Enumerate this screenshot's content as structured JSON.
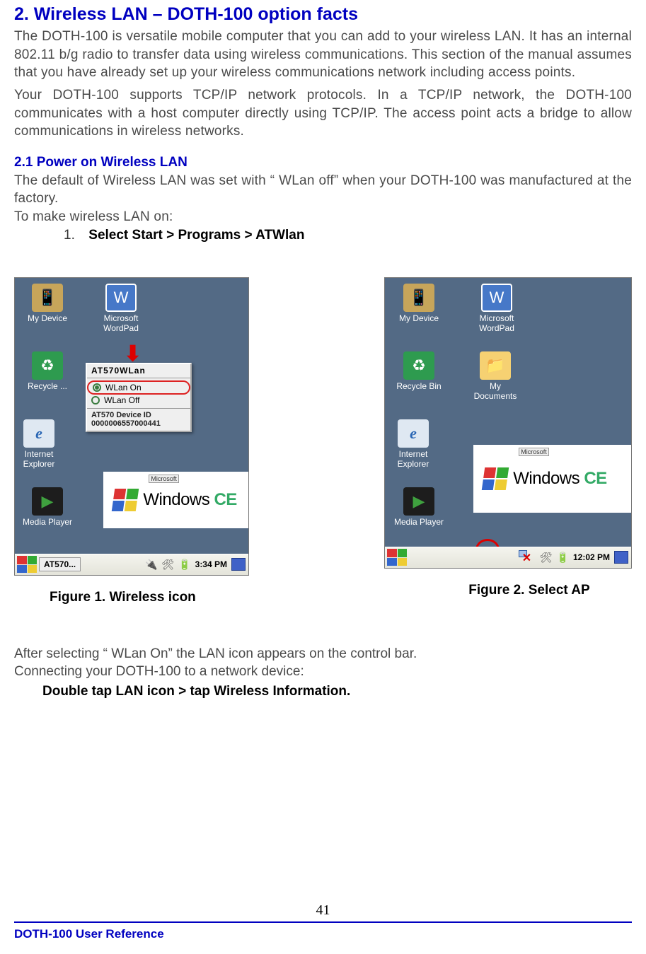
{
  "title": "2. Wireless LAN – DOTH-100 option facts",
  "p1": "The DOTH-100 is versatile mobile computer that you can add to your wireless LAN. It has an internal 802.11 b/g radio to transfer data using wireless communications. This section of the manual assumes that you have already set up your wireless communications network including access points.",
  "p2": "Your DOTH-100 supports TCP/IP network protocols. In a TCP/IP network, the DOTH-100 communicates with a host computer directly using TCP/IP. The access point acts a bridge to allow communications in wireless networks.",
  "h2": "2.1 Power on Wireless LAN",
  "p3": "The default of Wireless LAN was set with “ WLan off”  when your DOTH-100 was manufactured at the factory.",
  "p4": "To make wireless LAN on:",
  "list_num": "1.",
  "list_text": "Select Start > Programs > ATWlan",
  "fig1": {
    "caption": "Figure 1. Wireless icon",
    "icons": {
      "device": "My Device",
      "word": "Microsoft WordPad",
      "recycle": "Recycle ...",
      "ie": "Internet Explorer",
      "media": "Media Player"
    },
    "menu": {
      "title": "AT570WLan",
      "on": "WLan On",
      "off": "WLan Off",
      "devid_label": "AT570 Device ID",
      "devid_value": "0000006557000441"
    },
    "winlogo": {
      "ms": "Microsoft",
      "win": "Windows",
      "ce": "CE"
    },
    "taskbar": {
      "task": "AT570...",
      "time": "3:34 PM"
    }
  },
  "fig2": {
    "caption": "Figure 2. Select AP",
    "icons": {
      "device": "My Device",
      "word": "Microsoft WordPad",
      "recycle": "Recycle Bin",
      "docs": "My Documents",
      "ie": "Internet Explorer",
      "media": "Media Player"
    },
    "winlogo": {
      "ms": "Microsoft",
      "win": "Windows",
      "ce": "CE"
    },
    "taskbar": {
      "time": "12:02 PM"
    }
  },
  "after1": "After selecting “ WLan On”  the LAN icon appears on the control bar.",
  "after2": "Connecting your DOTH-100 to a network device:",
  "after3": "Double tap LAN icon > tap Wireless Information.",
  "page_number": "41",
  "footer": "DOTH-100 User Reference"
}
